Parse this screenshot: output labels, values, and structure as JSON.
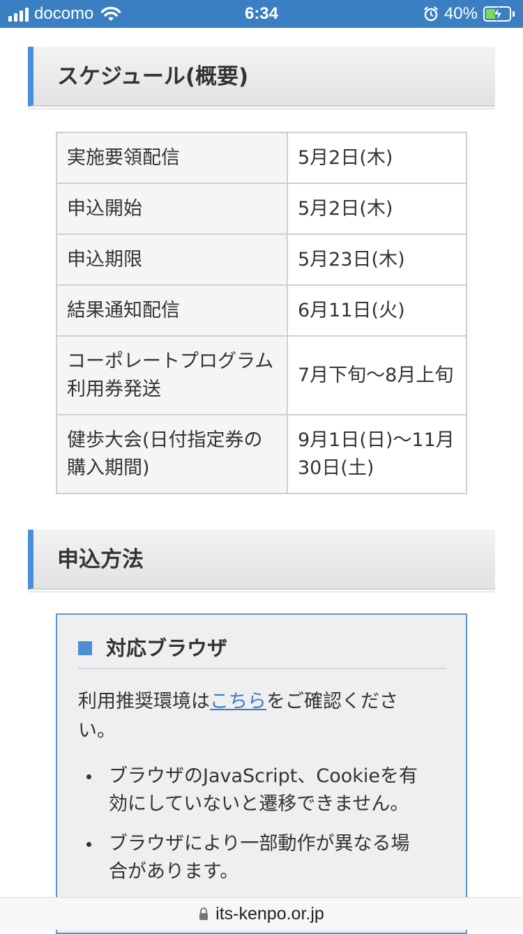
{
  "status_bar": {
    "carrier": "docomo",
    "time": "6:34",
    "battery_percent": "40%",
    "battery_level": 0.4,
    "bg_color": "#3a7fc2"
  },
  "schedule": {
    "heading": "スケジュール(概要)",
    "rows": [
      {
        "label": "実施要領配信",
        "value": "5月2日(木)"
      },
      {
        "label": "申込開始",
        "value": "5月2日(木)"
      },
      {
        "label": "申込期限",
        "value": "5月23日(木)"
      },
      {
        "label": "結果通知配信",
        "value": "6月11日(火)"
      },
      {
        "label": "コーポレートプログラム利用券発送",
        "value": "7月下旬〜8月上旬"
      },
      {
        "label": "健歩大会(日付指定券の購入期間)",
        "value": "9月1日(日)〜11月30日(土)"
      }
    ]
  },
  "apply": {
    "heading": "申込方法",
    "browser_box": {
      "title": "対応ブラウザ",
      "text_before": "利用推奨環境は",
      "link": "こちら",
      "text_after": "をご確認ください。",
      "bullets": [
        "ブラウザのJavaScript、Cookieを有効にしていないと遷移できません。",
        "ブラウザにより一部動作が異なる場合があります。"
      ]
    }
  },
  "url_bar": {
    "url": "its-kenpo.or.jp"
  },
  "colors": {
    "accent": "#4a8fd6",
    "link": "#3b7ac9"
  },
  "icons": [
    "signal-icon",
    "wifi-icon",
    "alarm-icon",
    "battery-icon",
    "lock-icon"
  ]
}
